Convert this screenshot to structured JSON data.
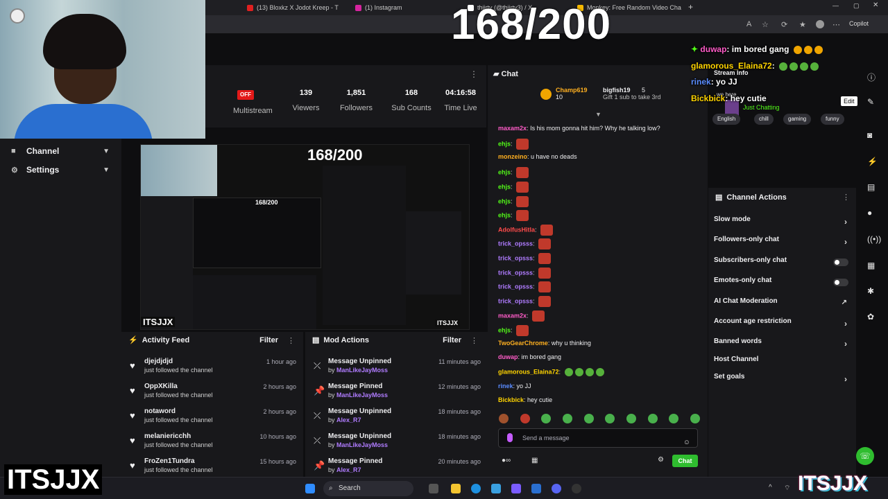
{
  "overlay": {
    "counter": "168/200",
    "brand_left": "ITSJJX",
    "brand_right": "ITSJJX"
  },
  "browser": {
    "tabs": [
      {
        "label": "(13) Bloxkz X Jodot Kreep - T",
        "color": "#e02020"
      },
      {
        "label": "(1) Instagram",
        "color": "#d6249f"
      },
      {
        "label": "thiirty (@thiirty3) / X",
        "color": "#ffffff"
      },
      {
        "label": "Monkey: Free Random Video Cha",
        "color": "#f5b800"
      }
    ],
    "copilot_label": "Copilot",
    "edit_tooltip": "Edit"
  },
  "sidebar": {
    "items": [
      {
        "label": "Channel",
        "icon": "grid-icon"
      },
      {
        "label": "Settings",
        "icon": "gear-icon"
      }
    ]
  },
  "stats": {
    "offline_badge": "OFF",
    "multistream_label": "Multistream",
    "items": [
      {
        "value": "139",
        "label": "Viewers"
      },
      {
        "value": "1,851",
        "label": "Followers"
      },
      {
        "value": "168",
        "label": "Sub Counts"
      },
      {
        "value": "04:16:58",
        "label": "Time Live"
      }
    ]
  },
  "preview": {
    "counter": "168/200",
    "inner_counter": "168/200",
    "watermark": "ITSJJX",
    "watermark2": "ITSJJX"
  },
  "activity_feed": {
    "title": "Activity Feed",
    "filter_label": "Filter",
    "rows": [
      {
        "user": "djejdjdjd",
        "text": "just followed the channel",
        "time": "1 hour ago"
      },
      {
        "user": "OppXKilla",
        "text": "just followed the channel",
        "time": "2 hours ago"
      },
      {
        "user": "notaword",
        "text": "just followed the channel",
        "time": "2 hours ago"
      },
      {
        "user": "melaniericchh",
        "text": "just followed the channel",
        "time": "10 hours ago"
      },
      {
        "user": "FroZen1Tundra",
        "text": "just followed the channel",
        "time": "15 hours ago"
      }
    ]
  },
  "mod_actions": {
    "title": "Mod Actions",
    "filter_label": "Filter",
    "by_label": "by",
    "rows": [
      {
        "action": "Message Unpinned",
        "by": "ManLikeJayMoss",
        "time": "11 minutes ago"
      },
      {
        "action": "Message Pinned",
        "by": "ManLikeJayMoss",
        "time": "12 minutes ago"
      },
      {
        "action": "Message Unpinned",
        "by": "Alex_R7",
        "time": "18 minutes ago"
      },
      {
        "action": "Message Unpinned",
        "by": "ManLikeJayMoss",
        "time": "18 minutes ago"
      },
      {
        "action": "Message Pinned",
        "by": "Alex_R7",
        "time": "20 minutes ago"
      }
    ]
  },
  "chat": {
    "title": "Chat",
    "gifters": [
      {
        "name": "Champ619",
        "count": "10"
      },
      {
        "name": "bigfish19",
        "count": "5"
      }
    ],
    "gift_prompt": "Gift 1 sub to take 3rd",
    "messages": [
      {
        "user": "maxam2x",
        "color": "#ff5cc8",
        "text": "Is his mom gonna hit him? Why he talking low?"
      },
      {
        "user": "ehjs",
        "color": "#53fc18",
        "text": ""
      },
      {
        "user": "monzeino",
        "color": "#ffb020",
        "text": "u have no deads"
      },
      {
        "user": "ehjs",
        "color": "#53fc18",
        "text": ""
      },
      {
        "user": "ehjs",
        "color": "#53fc18",
        "text": ""
      },
      {
        "user": "ehjs",
        "color": "#53fc18",
        "text": ""
      },
      {
        "user": "ehjs",
        "color": "#53fc18",
        "text": ""
      },
      {
        "user": "AdolfusHitla",
        "color": "#ff4b4b",
        "text": ""
      },
      {
        "user": "trick_opsss",
        "color": "#b07cff",
        "text": ""
      },
      {
        "user": "trick_opsss",
        "color": "#b07cff",
        "text": ""
      },
      {
        "user": "trick_opsss",
        "color": "#b07cff",
        "text": ""
      },
      {
        "user": "trick_opsss",
        "color": "#b07cff",
        "text": ""
      },
      {
        "user": "trick_opsss",
        "color": "#b07cff",
        "text": ""
      },
      {
        "user": "maxam2x",
        "color": "#ff5cc8",
        "text": ""
      },
      {
        "user": "ehjs",
        "color": "#53fc18",
        "text": ""
      },
      {
        "user": "TwoGearChrome",
        "color": "#ffb020",
        "text": "why u thinking"
      },
      {
        "user": "duwap",
        "color": "#ff5cc8",
        "text": "im bored gang"
      },
      {
        "user": "glamorous_Elaina72",
        "color": "#ffd400",
        "text": ""
      },
      {
        "user": "rinek",
        "color": "#5a8cff",
        "text": "yo JJ"
      },
      {
        "user": "Bickbick",
        "color": "#ffd400",
        "text": "hey cutie"
      }
    ],
    "input_placeholder": "Send a message",
    "send_label": "Chat"
  },
  "overlay_chat": [
    {
      "user": "duwap",
      "text": "im bored gang",
      "color": "#ff5cc8"
    },
    {
      "user": "glamorous_Elaina72",
      "text": "",
      "color": "#ffd400"
    },
    {
      "user": "rinek",
      "text": "yo JJ",
      "color": "#5a8cff"
    },
    {
      "user": "Bickbick",
      "text": "hey cutie",
      "color": "#ffd400"
    }
  ],
  "stream_info": {
    "title": "Stream Info",
    "stream_title": "we here",
    "category": "Just Chatting",
    "tags": [
      "English",
      "chill",
      "gaming",
      "funny"
    ]
  },
  "channel_actions": {
    "title": "Channel Actions",
    "items": [
      {
        "label": "Slow mode",
        "control": "chevron"
      },
      {
        "label": "Followers-only chat",
        "control": "chevron"
      },
      {
        "label": "Subscribers-only chat",
        "control": "toggle"
      },
      {
        "label": "Emotes-only chat",
        "control": "toggle"
      },
      {
        "label": "AI Chat Moderation",
        "control": "external"
      },
      {
        "label": "Account age restriction",
        "control": "chevron"
      },
      {
        "label": "Banned words",
        "control": "chevron"
      },
      {
        "label": "Host Channel",
        "control": "none"
      },
      {
        "label": "Set goals",
        "control": "chevron"
      }
    ]
  },
  "taskbar": {
    "search_label": "Search"
  }
}
